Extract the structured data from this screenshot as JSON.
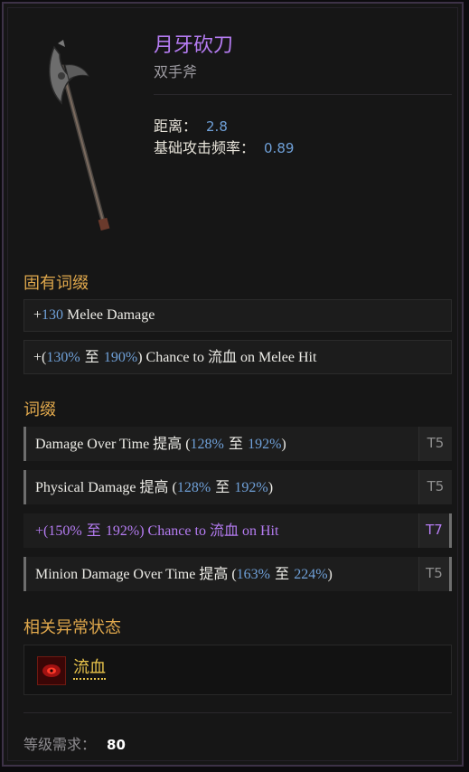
{
  "item": {
    "name": "月牙砍刀",
    "type": "双手斧",
    "stats": [
      {
        "label": "距离：",
        "value": "2.8"
      },
      {
        "label": "基础攻击频率：",
        "value": "0.89"
      }
    ]
  },
  "implicit": {
    "title": "固有词缀",
    "lines": [
      {
        "prefix": "+",
        "num": "130",
        "text": " Melee Damage"
      },
      {
        "prefix": "+(",
        "num1": "130%",
        "mid": " 至 ",
        "num2": "190%",
        "suffix_a": ") Chance to ",
        "cjk": "流血",
        "suffix_b": " on Melee Hit"
      }
    ]
  },
  "affixes": {
    "title": "词缀",
    "lines": [
      {
        "pre": "Damage Over Time ",
        "cjk": "提高",
        "open": " (",
        "num1": "128%",
        "mid": " 至 ",
        "num2": "192%",
        "close": ")",
        "tier": "T5"
      },
      {
        "pre": "Physical Damage ",
        "cjk": "提高",
        "open": " (",
        "num1": "128%",
        "mid": " 至 ",
        "num2": "192%",
        "close": ")",
        "tier": "T5"
      },
      {
        "pre": "+(",
        "num1": "150%",
        "mid": " 至 ",
        "num2": "192%",
        "post": ") Chance to ",
        "cjk": "流血",
        "end": " on Hit",
        "tier": "T7"
      },
      {
        "pre": "Minion Damage Over Time ",
        "cjk": "提高",
        "open": " (",
        "num1": "163%",
        "mid": " 至 ",
        "num2": "224%",
        "close": ")",
        "tier": "T5"
      }
    ]
  },
  "ailments": {
    "title": "相关异常状态",
    "items": [
      {
        "label": "流血",
        "icon": "bleed-icon"
      }
    ]
  },
  "requirement": {
    "label": "等级需求：",
    "value": "80"
  },
  "colors": {
    "unique_purple": "#b57cf2",
    "section_gold": "#e0a84c",
    "number_blue": "#6fa0d8",
    "ailment_gold": "#e9c44b"
  }
}
